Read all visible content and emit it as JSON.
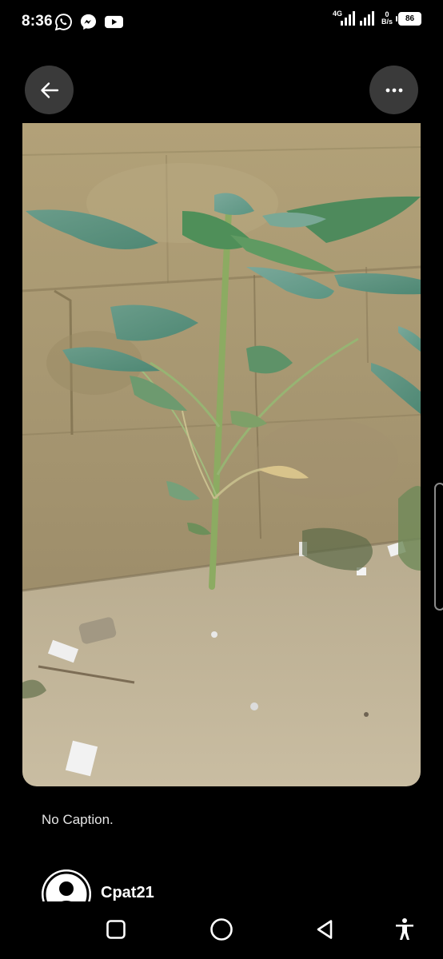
{
  "status_bar": {
    "time": "8:36",
    "notification_icons": [
      "whatsapp-icon",
      "messenger-icon",
      "youtube-icon"
    ],
    "network_type": "4G",
    "data_speed_value": "0",
    "data_speed_unit": "B/s",
    "battery_level": "86"
  },
  "toolbar": {
    "back_icon": "arrow-left-icon",
    "more_icon": "more-horizontal-icon"
  },
  "post": {
    "caption": "No Caption.",
    "author_name": "Cpat21"
  },
  "nav_bar": {
    "buttons": [
      "recents-icon",
      "home-icon",
      "back-triangle-icon",
      "accessibility-icon"
    ]
  },
  "colors": {
    "background": "#000000",
    "button_background": "#3a3a3a",
    "text": "#ffffff",
    "caption_text": "#e6e6e6"
  }
}
